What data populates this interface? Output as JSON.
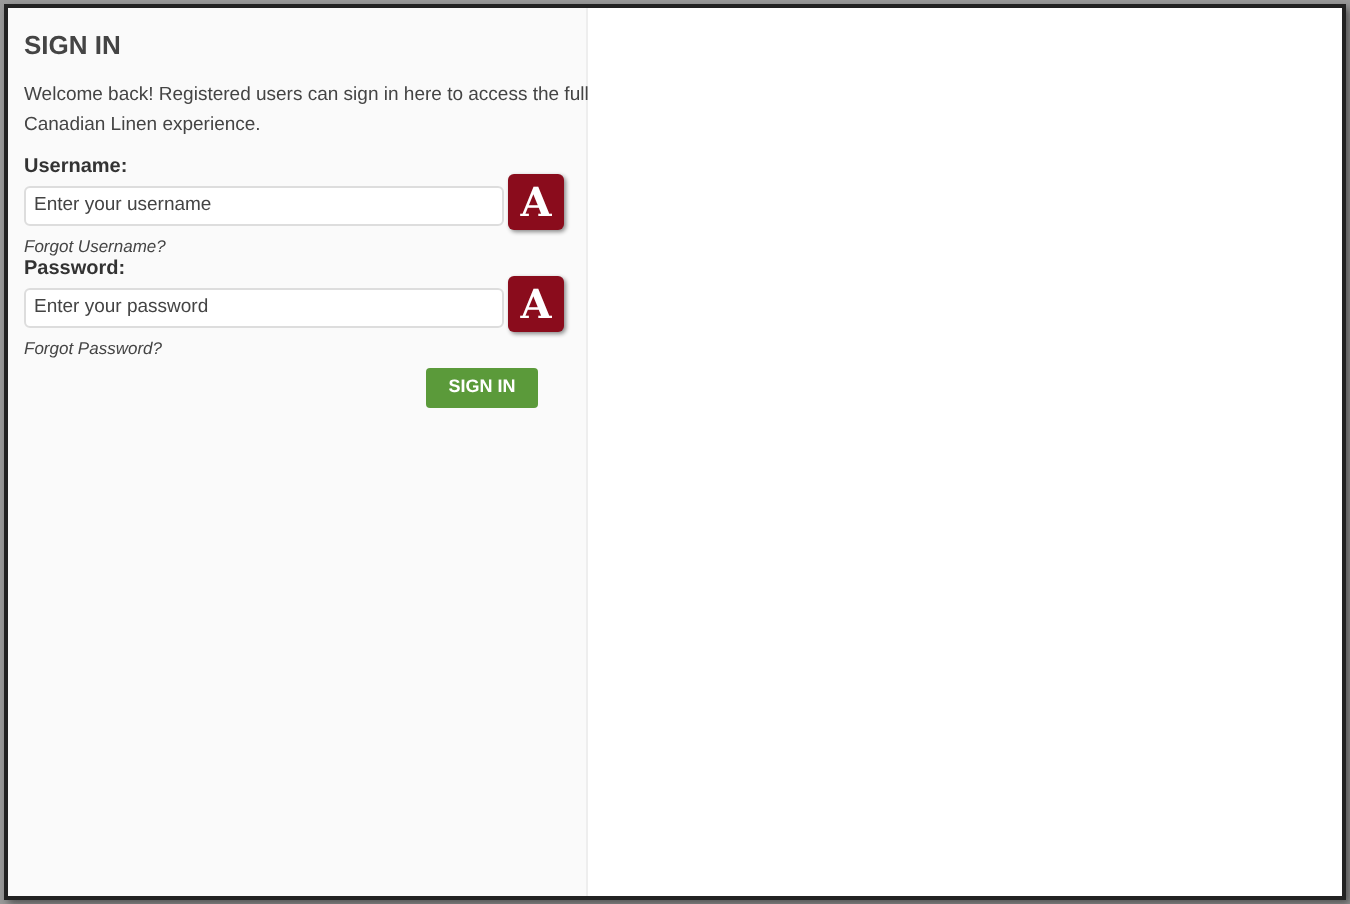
{
  "signin": {
    "title": "SIGN IN",
    "intro": "Welcome back! Registered users can sign in here to access the full Canadian Linen experience.",
    "fields": [
      {
        "label": "Username:",
        "placeholder": "Enter your username",
        "badge": "A",
        "link": "Forgot Username?"
      },
      {
        "label": "Password:",
        "placeholder": "Enter your password",
        "badge": "A",
        "link": "Forgot Password?"
      }
    ],
    "button": "SIGN IN"
  }
}
